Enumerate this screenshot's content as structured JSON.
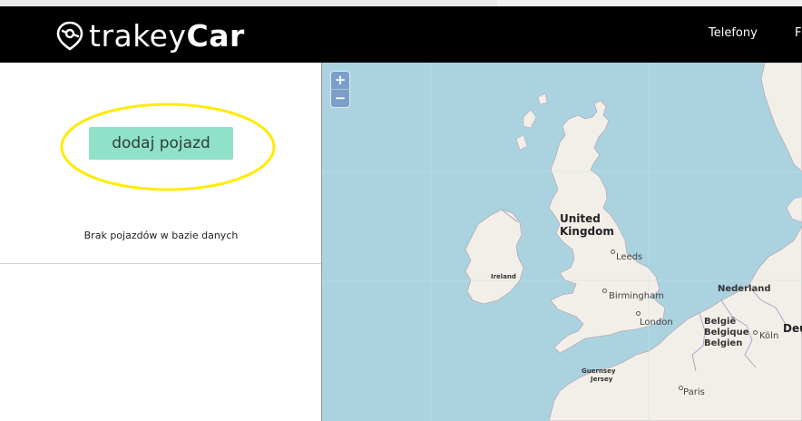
{
  "header": {
    "logo_part1": "trakey",
    "logo_part2": "Car",
    "nav": {
      "item1": "Telefony",
      "item2": "F"
    }
  },
  "sidebar": {
    "add_button_label": "dodaj pojazd",
    "empty_message": "Brak pojazdów w bazie danych"
  },
  "map": {
    "zoom_in": "+",
    "zoom_out": "−",
    "labels": {
      "uk_line1": "United",
      "uk_line2": "Kingdom",
      "leeds": "Leeds",
      "ireland": "Ireland",
      "birmingham": "Birmingham",
      "london": "London",
      "nederland": "Nederland",
      "belgie1": "België",
      "belgie2": "Belgique",
      "belgie3": "Belgien",
      "koln": "Köln",
      "deutschland": "Deu",
      "guernsey": "Guernsey",
      "jersey": "Jersey",
      "paris": "Paris"
    }
  },
  "colors": {
    "navbar": "#000000",
    "button": "#8fe1c8",
    "highlight": "#ffeb00",
    "sea": "#aad3df",
    "land": "#f2efe9"
  }
}
